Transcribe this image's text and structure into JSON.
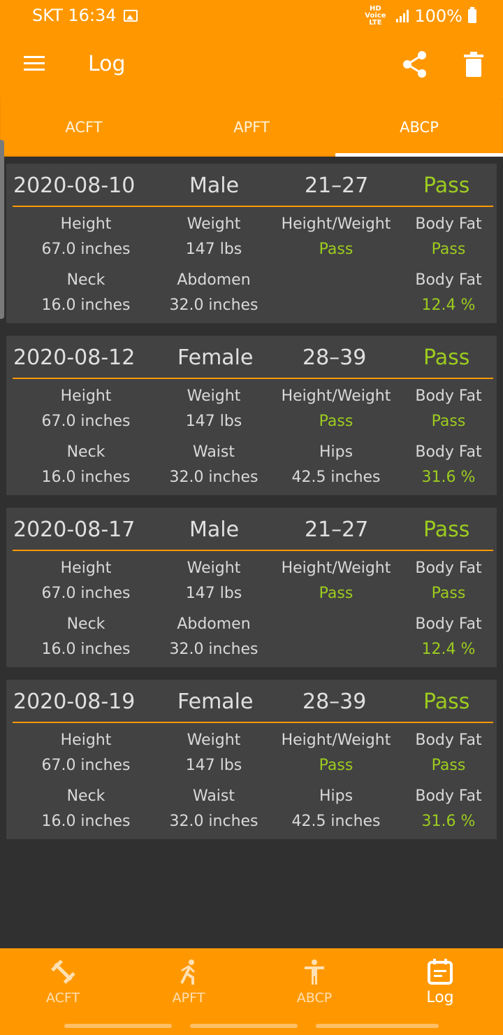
{
  "status_bar": {
    "carrier_time": "SKT 16:34",
    "network": "HD Voice LTE",
    "battery": "100%"
  },
  "app_bar": {
    "title": "Log",
    "icons": [
      "menu-icon",
      "share-icon",
      "trash-icon"
    ]
  },
  "tabs": [
    {
      "label": "ACFT",
      "active": false
    },
    {
      "label": "APFT",
      "active": false
    },
    {
      "label": "ABCP",
      "active": true
    }
  ],
  "entries": [
    {
      "date": "2020-08-10",
      "gender": "Male",
      "age": "21–27",
      "result": "Pass",
      "height_label": "Height",
      "height": "67.0 inches",
      "weight_label": "Weight",
      "weight": "147 lbs",
      "hw_label": "Height/Weight",
      "hw": "Pass",
      "bf_label": "Body Fat",
      "bf": "Pass",
      "m1_label": "Neck",
      "m1": "16.0 inches",
      "m2_label": "Abdomen",
      "m2": "32.0 inches",
      "m3_label": "",
      "m3": "",
      "bfp_label": "Body Fat",
      "bfp": "12.4 %"
    },
    {
      "date": "2020-08-12",
      "gender": "Female",
      "age": "28–39",
      "result": "Pass",
      "height_label": "Height",
      "height": "67.0 inches",
      "weight_label": "Weight",
      "weight": "147 lbs",
      "hw_label": "Height/Weight",
      "hw": "Pass",
      "bf_label": "Body Fat",
      "bf": "Pass",
      "m1_label": "Neck",
      "m1": "16.0 inches",
      "m2_label": "Waist",
      "m2": "32.0 inches",
      "m3_label": "Hips",
      "m3": "42.5 inches",
      "bfp_label": "Body Fat",
      "bfp": "31.6 %"
    },
    {
      "date": "2020-08-17",
      "gender": "Male",
      "age": "21–27",
      "result": "Pass",
      "height_label": "Height",
      "height": "67.0 inches",
      "weight_label": "Weight",
      "weight": "147 lbs",
      "hw_label": "Height/Weight",
      "hw": "Pass",
      "bf_label": "Body Fat",
      "bf": "Pass",
      "m1_label": "Neck",
      "m1": "16.0 inches",
      "m2_label": "Abdomen",
      "m2": "32.0 inches",
      "m3_label": "",
      "m3": "",
      "bfp_label": "Body Fat",
      "bfp": "12.4 %"
    },
    {
      "date": "2020-08-19",
      "gender": "Female",
      "age": "28–39",
      "result": "Pass",
      "height_label": "Height",
      "height": "67.0 inches",
      "weight_label": "Weight",
      "weight": "147 lbs",
      "hw_label": "Height/Weight",
      "hw": "Pass",
      "bf_label": "Body Fat",
      "bf": "Pass",
      "m1_label": "Neck",
      "m1": "16.0 inches",
      "m2_label": "Waist",
      "m2": "32.0 inches",
      "m3_label": "Hips",
      "m3": "42.5 inches",
      "bfp_label": "Body Fat",
      "bfp": "31.6 %"
    }
  ],
  "bottom_nav": [
    {
      "label": "ACFT",
      "icon": "dumbbell-icon",
      "active": false
    },
    {
      "label": "APFT",
      "icon": "running-icon",
      "active": false
    },
    {
      "label": "ABCP",
      "icon": "person-icon",
      "active": false
    },
    {
      "label": "Log",
      "icon": "calendar-icon",
      "active": true
    }
  ],
  "colors": {
    "primary": "#ff9800",
    "background": "#303030",
    "card": "#424242",
    "pass": "#9ccc1f"
  }
}
